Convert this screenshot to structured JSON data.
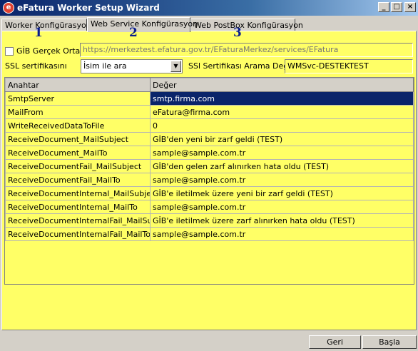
{
  "window": {
    "title": "eFatura Worker Setup Wizard",
    "app_icon_glyph": "e",
    "minimize_glyph": "_",
    "maximize_glyph": "□",
    "close_glyph": "×"
  },
  "tabs": [
    {
      "label": "Worker Konfigürasyon",
      "number": "1",
      "active": false
    },
    {
      "label": "Web Service Konfigürasyon",
      "number": "2",
      "active": true
    },
    {
      "label": "Web PostBox Konfigürasyon",
      "number": "3",
      "active": false
    }
  ],
  "form": {
    "gib_checkbox_label": "GİB Gerçek Ortam",
    "gib_checked": false,
    "service_url": "https://merkeztest.efatura.gov.tr/EFaturaMerkez/services/EFatura",
    "ssl_label": "SSL sertifikasını",
    "ssl_select_value": "İsim ile ara",
    "ssl_search_label": "SSl Sertifikası Arama Değeri",
    "ssl_search_value": "WMSvc-DESTEKTEST"
  },
  "grid": {
    "columns": [
      "Anahtar",
      "Değer"
    ],
    "selected_row": 0,
    "rows": [
      [
        "SmtpServer",
        "smtp.firma.com"
      ],
      [
        "MailFrom",
        "eFatura@firma.com"
      ],
      [
        "WriteReceivedDataToFile",
        "0"
      ],
      [
        "ReceiveDocument_MailSubject",
        "GİB'den yeni bir zarf geldi (TEST)"
      ],
      [
        "ReceiveDocument_MailTo",
        "sample@sample.com.tr"
      ],
      [
        "ReceiveDocumentFail_MailSubject",
        "GİB'den gelen zarf alınırken hata oldu (TEST)"
      ],
      [
        "ReceiveDocumentFail_MailTo",
        "sample@sample.com.tr"
      ],
      [
        "ReceiveDocumentInternal_MailSubject",
        "GİB'e iletilmek üzere yeni bir zarf geldi (TEST)"
      ],
      [
        "ReceiveDocumentInternal_MailTo",
        "sample@sample.com.tr"
      ],
      [
        "ReceiveDocumentInternalFail_MailSubject",
        "GİB'e iletilmek üzere zarf alınırken hata oldu (TEST)"
      ],
      [
        "ReceiveDocumentInternalFail_MailTo",
        "sample@sample.com.tr"
      ]
    ]
  },
  "buttons": {
    "back": "Geri",
    "start": "Başla"
  },
  "colors": {
    "panel_bg": "#ffff66",
    "selection": "#0a246a",
    "tab_number": "#0a1e8c"
  }
}
